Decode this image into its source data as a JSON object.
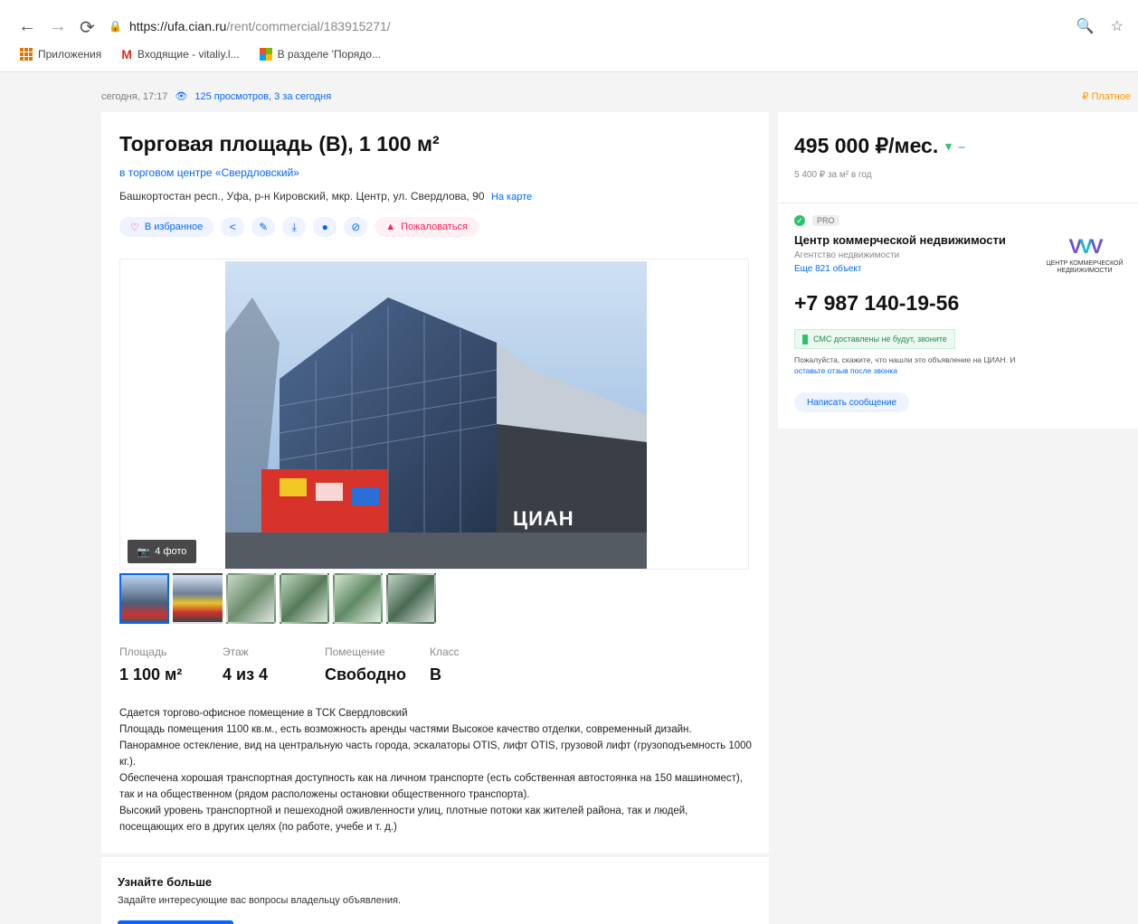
{
  "browser": {
    "back_icon": "arrow-left-icon",
    "forward_icon": "arrow-right-icon",
    "reload_icon": "reload-icon",
    "url_host": "https://ufa.cian.ru",
    "url_path": "/rent/commercial/183915271/",
    "bookmarks": [
      {
        "label": "Приложения"
      },
      {
        "label": "Входящие - vitaliy.l..."
      },
      {
        "label": "В разделе 'Порядо..."
      }
    ]
  },
  "meta": {
    "date": "сегодня, 17:17",
    "views": "125 просмотров, 3 за сегодня",
    "complain": "₽ Платное"
  },
  "listing": {
    "title": "Торговая площадь (B), 1 100 м²",
    "subtitle": "в торговом центре «Свердловский»",
    "address": "Башкортостан респ., Уфа, р-н Кировский, мкр. Центр, ул. Свердлова, 90",
    "map_link": "На карте",
    "favorite_label": "В избранное",
    "report_label": "Пожаловаться",
    "photo_count": "4 фото",
    "watermark": "ЦИАН",
    "facts": [
      {
        "label": "Площадь",
        "value": "1 100 м²"
      },
      {
        "label": "Этаж",
        "value": "4 из 4"
      },
      {
        "label": "Помещение",
        "value": "Свободно"
      },
      {
        "label": "Класс",
        "value": "B"
      }
    ],
    "description": [
      "Сдается торгово-офисное помещение в ТСК Свердловский",
      "Площадь помещения 1100 кв.м., есть возможность аренды частями Высокое качество отделки, современный дизайн. Панорамное остекление, вид на центральную часть города, эскалаторы OTIS, лифт OTIS, грузовой лифт (грузоподъемность 1000 кг.).",
      "Обеспечена хорошая транспортная доступность как на личном транспорте (есть собственная автостоянка на 150 машиномест), так и на общественном (рядом расположены остановки общественного транспорта).",
      "Высокий уровень транспортной и пешеходной оживленности улиц, плотные потоки как жителей района, так и людей, посещающих его в других целях (по работе, учебе и т. д.)"
    ]
  },
  "more": {
    "title": "Узнайте больше",
    "subtitle": "Задайте интересующие вас вопросы владельцу объявления."
  },
  "sidebar": {
    "price": "495 000 ₽/мес.",
    "price_sub": "5 400 ₽ за м² в год",
    "pro_badge": "PRO",
    "agency": "Центр коммерческой недвижимости",
    "agency_type": "Агентство недвижимости",
    "agency_more": "Еще 821 объект",
    "logo_text": "ЦЕНТР КОММЕРЧЕСКОЙ НЕДВИЖИМОСТИ",
    "phone": "+7 987 140-19-56",
    "sms": "СМС доставлены не будут, звоните",
    "note_text": "Пожалуйста, скажите, что нашли это объявление на ЦИАН. И",
    "note_link": "оставьте отзыв после звонка",
    "write_label": "Написать сообщение"
  },
  "colors": {
    "accent": "#0468ff",
    "favorite": "#ff1f5a",
    "success": "#2dc36a"
  }
}
